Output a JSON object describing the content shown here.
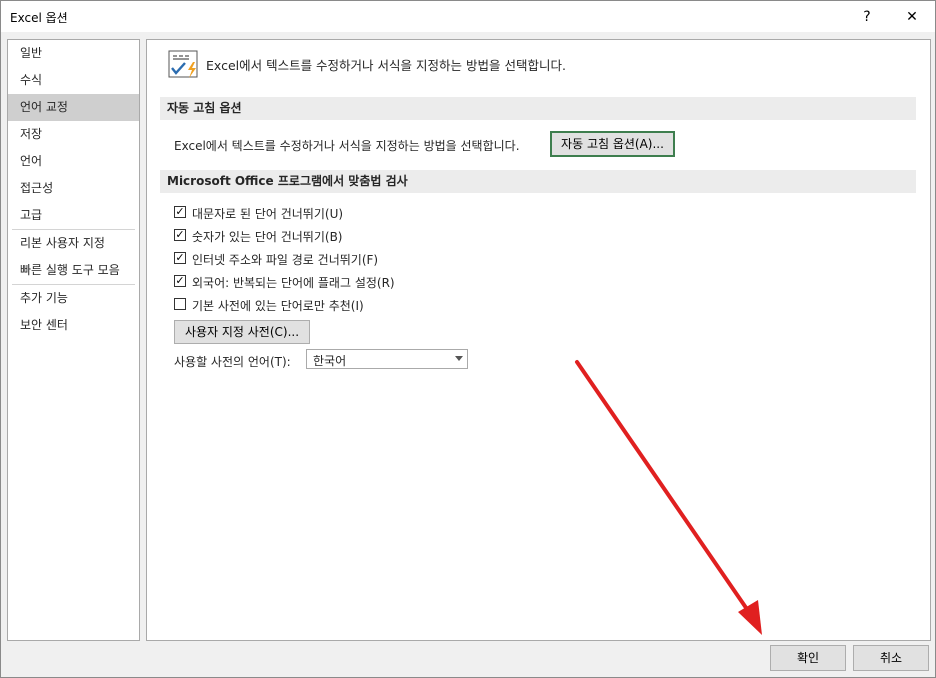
{
  "window": {
    "title": "Excel 옵션",
    "help": "?",
    "close": "✕"
  },
  "nav": {
    "items": [
      {
        "label": "일반"
      },
      {
        "label": "수식"
      },
      {
        "label": "언어 교정"
      },
      {
        "label": "저장"
      },
      {
        "label": "언어"
      },
      {
        "label": "접근성"
      },
      {
        "label": "고급"
      },
      {
        "label": "리본 사용자 지정"
      },
      {
        "label": "빠른 실행 도구 모음"
      },
      {
        "label": "추가 기능"
      },
      {
        "label": "보안 센터"
      }
    ],
    "active_index": 2
  },
  "header": {
    "text": "Excel에서 텍스트를 수정하거나 서식을 지정하는 방법을 선택합니다."
  },
  "autocorrect": {
    "title": "자동 고침 옵션",
    "desc": "Excel에서 텍스트를 수정하거나 서식을 지정하는 방법을 선택합니다.",
    "button": "자동 고침 옵션(A)..."
  },
  "spelling": {
    "title": "Microsoft Office 프로그램에서 맞춤법 검사",
    "options": [
      {
        "label": "대문자로 된 단어 건너뛰기(U)",
        "checked": true
      },
      {
        "label": "숫자가 있는 단어 건너뛰기(B)",
        "checked": true
      },
      {
        "label": "인터넷 주소와 파일 경로 건너뛰기(F)",
        "checked": true
      },
      {
        "label": "외국어: 반복되는 단어에 플래그 설정(R)",
        "checked": true
      },
      {
        "label": "기본 사전에 있는 단어로만 추천(I)",
        "checked": false
      }
    ],
    "custom_dict_button": "사용자 지정 사전(C)...",
    "lang_label": "사용할 사전의 언어(T):",
    "lang_value": "한국어"
  },
  "footer": {
    "ok": "확인",
    "cancel": "취소"
  },
  "colors": {
    "annotation_arrow": "#e02020",
    "focus_border": "#3e7e4e"
  }
}
